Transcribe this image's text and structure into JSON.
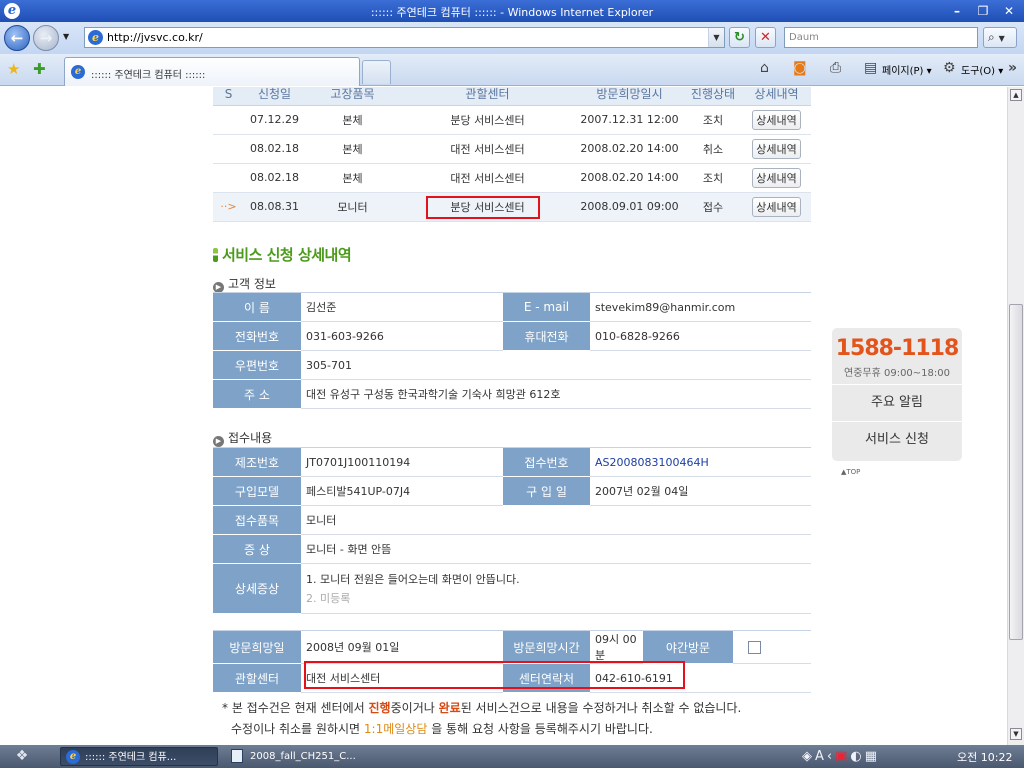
{
  "window": {
    "title": ":::::: 주연테크 컴퓨터 :::::: - Windows Internet Explorer",
    "minimize": "–",
    "maximize": "❐",
    "close": "✕"
  },
  "address": {
    "url": "http://jvsvc.co.kr/",
    "search_placeholder": "Daum"
  },
  "tabs": [
    {
      "label": ":::::: 주연테크 컴퓨터 ::::::"
    }
  ],
  "commands": {
    "page": "페이지(P)",
    "tools": "도구(O)"
  },
  "history": {
    "headers": [
      "S",
      "신청일",
      "고장품목",
      "관할센터",
      "방문희망일시",
      "진행상태",
      "상세내역"
    ],
    "rows": [
      {
        "marker": "",
        "date": "07.12.29",
        "item": "본체",
        "center": "분당 서비스센터",
        "visit": "2007.12.31 12:00",
        "status": "조치",
        "button": "상세내역"
      },
      {
        "marker": "",
        "date": "08.02.18",
        "item": "본체",
        "center": "대전 서비스센터",
        "visit": "2008.02.20 14:00",
        "status": "취소",
        "button": "상세내역"
      },
      {
        "marker": "",
        "date": "08.02.18",
        "item": "본체",
        "center": "대전 서비스센터",
        "visit": "2008.02.20 14:00",
        "status": "조치",
        "button": "상세내역"
      },
      {
        "marker": "··>",
        "date": "08.08.31",
        "item": "모니터",
        "center": "분당 서비스센터",
        "visit": "2008.09.01 09:00",
        "status": "접수",
        "button": "상세내역"
      }
    ]
  },
  "detail": {
    "title": "서비스 신청 상세내역",
    "customer": {
      "heading": "고객 정보",
      "name_label": "이      름",
      "name": "김선준",
      "email_label": "E - mail",
      "email": "stevekim89@hanmir.com",
      "phone_label": "전화번호",
      "phone": "031-603-9266",
      "mobile_label": "휴대전화",
      "mobile": "010-6828-9266",
      "zip_label": "우편번호",
      "zip": "305-701",
      "addr_label": "주      소",
      "address": "대전 유성구 구성동 한국과학기술 기숙사 희망관 612호"
    },
    "receipt": {
      "heading": "접수내용",
      "serial_label": "제조번호",
      "serial": "JT0701J100110194",
      "receipt_no_label": "접수번호",
      "receipt_no": "AS2008083100464H",
      "model_label": "구입모델",
      "model": "페스티발541UP-07J4",
      "purchase_label": "구 입 일",
      "purchase": "2007년 02월 04일",
      "item_label": "접수품목",
      "item": "모니터",
      "symptom_label": "증      상",
      "symptom": "모니터 - 화면 안뜸",
      "detail_label": "상세증상",
      "detail_1": "1. 모니터 전원은 들어오는데 화면이 안뜹니다.",
      "detail_2": "2. 미등록"
    },
    "visit": {
      "date_label": "방문희망일",
      "date": "2008년 09월 01일",
      "time_label": "방문희망시간",
      "time": "09시 00분",
      "night_label": "야간방문",
      "center_label": "관할센터",
      "center": "대전 서비스센터",
      "contact_label": "센터연락처",
      "contact": "042-610-6191"
    },
    "notice": {
      "p1": "* 본 접수건은 현재 센터에서 ",
      "hl1": "진행",
      "p2": "중이거나 ",
      "hl2": "완료",
      "p3": "된 서비스건으로 내용을 수정하거나 취소할 수 없습니다.",
      "p4": "수정이나 취소를 원하시면 ",
      "hl3": "1:1메일상담",
      "p5": " 을 통해 요청 사항을 등록해주시기 바랍니다."
    }
  },
  "sidebar": {
    "phone": "1588-1118",
    "hours": "연중무휴 09:00~18:00",
    "menu1": "주요 알림",
    "menu2": "서비스 신청",
    "top": "▲TOP"
  },
  "taskbar": {
    "item1": ":::::: 주연테크 컴퓨...",
    "item2": "2008_fall_CH251_C...",
    "clock": "오전 10:22"
  }
}
